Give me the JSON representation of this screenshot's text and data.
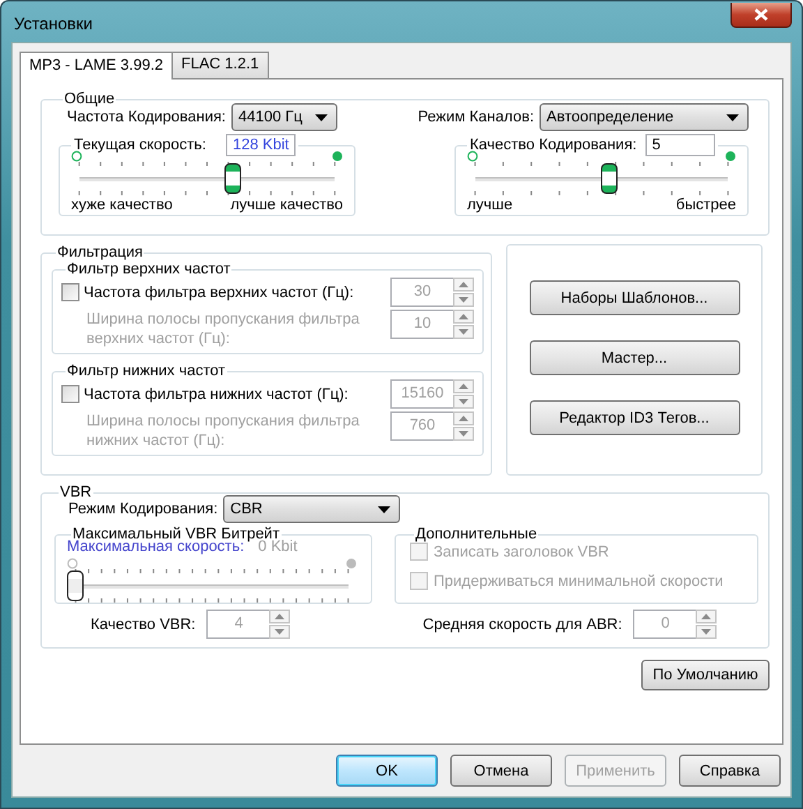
{
  "window": {
    "title": "Установки"
  },
  "tabs": [
    {
      "label": "MP3 - LAME 3.99.2",
      "selected": true
    },
    {
      "label": "FLAC 1.2.1",
      "selected": false
    }
  ],
  "general": {
    "title": "Общие",
    "sample_rate": {
      "label": "Частота Кодирования:",
      "value": "44100 Гц"
    },
    "channel_mode": {
      "label": "Режим Каналов:",
      "value": "Автоопределение"
    },
    "bitrate": {
      "label": "Текущая скорость:",
      "value": "128 Kbit",
      "level": 0.6,
      "left_label": "хуже качество",
      "right_label": "лучше качество"
    },
    "quality": {
      "label": "Качество Кодирования:",
      "value": "5",
      "level": 0.53,
      "left_label": "лучше",
      "right_label": "быстрее"
    }
  },
  "filtering": {
    "title": "Фильтрация",
    "groups": [
      {
        "title": "Фильтр верхних частот",
        "checkbox": {
          "label": "Частота фильтра верхних частот (Гц):",
          "checked": false
        },
        "cutoff": {
          "value": "30",
          "disabled": true
        },
        "width": {
          "label": "Ширина полосы пропускания фильтра верхних частот (Гц):",
          "value": "10",
          "disabled": true
        }
      },
      {
        "title": "Фильтр нижних частот",
        "checkbox": {
          "label": "Частота фильтра нижних частот (Гц):",
          "checked": false
        },
        "cutoff": {
          "value": "15160",
          "disabled": true
        },
        "width": {
          "label": "Ширина полосы пропускания фильтра нижних частот (Гц):",
          "value": "760",
          "disabled": true
        }
      }
    ]
  },
  "tools": [
    "Наборы Шаблонов...",
    "Мастер...",
    "Редактор ID3 Тегов..."
  ],
  "vbr": {
    "title": "VBR",
    "mode": {
      "label": "Режим Кодирования:",
      "value": "CBR"
    },
    "max_bitrate": {
      "title": "Максимальный VBR Битрейт",
      "label": "Максимальная скорость:",
      "value": "0 Kbit",
      "level": 0,
      "disabled": true
    },
    "extra": {
      "title": "Дополнительные",
      "options": [
        {
          "label": "Записать заголовок VBR",
          "checked": false,
          "disabled": true
        },
        {
          "label": "Придерживаться минимальной скорости",
          "checked": false,
          "disabled": true
        }
      ]
    },
    "vbr_quality": {
      "label": "Качество VBR:",
      "value": "4",
      "disabled": true
    },
    "abr": {
      "label": "Средняя скорость для ABR:",
      "value": "0",
      "disabled": true
    }
  },
  "default_button": "По Умолчанию",
  "dialog_buttons": [
    {
      "label": "OK",
      "default": true,
      "disabled": false
    },
    {
      "label": "Отмена",
      "default": false,
      "disabled": false
    },
    {
      "label": "Применить",
      "default": false,
      "disabled": true
    },
    {
      "label": "Справка",
      "default": false,
      "disabled": false
    }
  ]
}
